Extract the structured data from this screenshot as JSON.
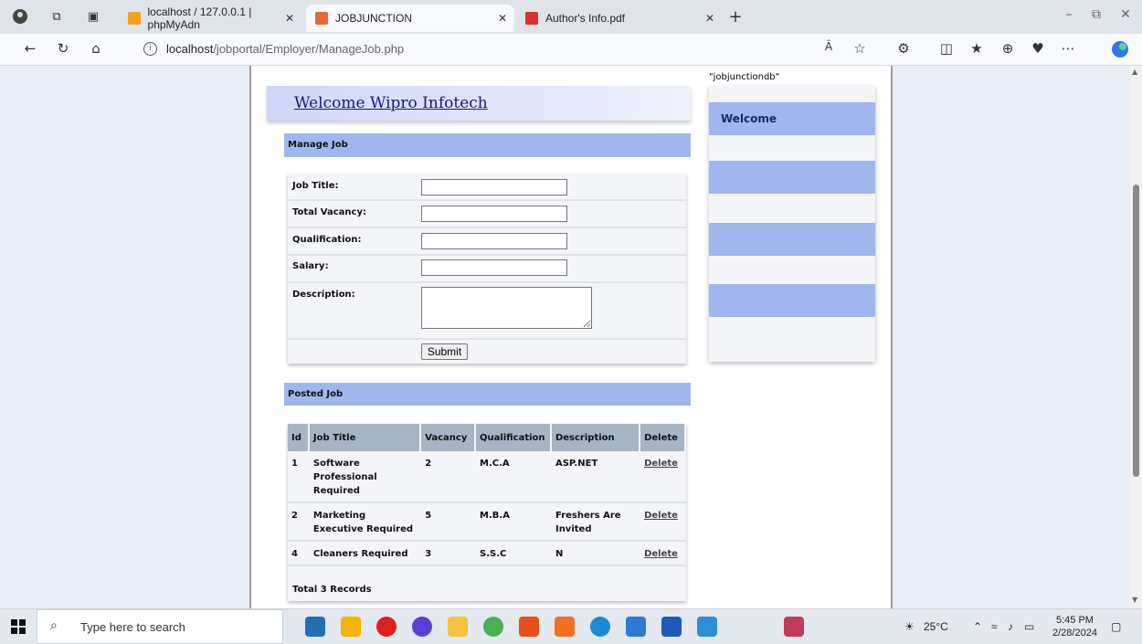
{
  "browser": {
    "tabs": [
      {
        "title": "localhost / 127.0.0.1 | phpMyAdn",
        "active": false
      },
      {
        "title": "JOBJUNCTION",
        "active": true
      },
      {
        "title": "Author's Info.pdf",
        "active": false
      }
    ],
    "url_host": "localhost",
    "url_path": "/jobportal/Employer/ManageJob.php"
  },
  "page": {
    "db_name": "\"jobjunctiondb\"",
    "welcome_title": "Welcome Wipro Infotech",
    "manage_job": {
      "header": "Manage Job",
      "fields": [
        {
          "label": "Job Title:",
          "value": ""
        },
        {
          "label": "Total Vacancy:",
          "value": ""
        },
        {
          "label": "Qualification:",
          "value": ""
        },
        {
          "label": "Salary:",
          "value": ""
        },
        {
          "label": "Description:",
          "value": ""
        }
      ],
      "submit_label": "Submit"
    },
    "posted_job": {
      "header": "Posted Job",
      "columns": [
        "Id",
        "Job Title",
        "Vacancy",
        "Qualification",
        "Description",
        "Delete"
      ],
      "rows": [
        {
          "id": "1",
          "title": "Software Professional Required",
          "vacancy": "2",
          "qualification": "M.C.A",
          "description": "ASP.NET",
          "delete": "Delete"
        },
        {
          "id": "2",
          "title": "Marketing Executive Required",
          "vacancy": "5",
          "qualification": "M.B.A",
          "description": "Freshers Are Invited",
          "delete": "Delete"
        },
        {
          "id": "4",
          "title": "Cleaners Required",
          "vacancy": "3",
          "qualification": "S.S.C",
          "description": "N",
          "delete": "Delete"
        }
      ],
      "total": "Total 3 Records"
    },
    "sidebar": {
      "items": [
        "Welcome",
        "",
        "",
        ""
      ]
    }
  },
  "taskbar": {
    "search_placeholder": "Type here to search",
    "temperature": "25°C",
    "time": "5:45 PM",
    "date": "2/28/2024"
  }
}
